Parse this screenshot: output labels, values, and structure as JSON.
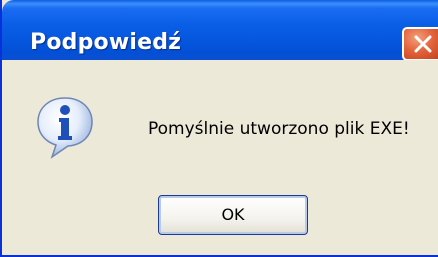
{
  "dialog": {
    "title": "Podpowiedź",
    "message": "Pomyślnie utworzono plik EXE!",
    "ok_label": "OK",
    "icon": "info-icon",
    "close_icon": "close-icon"
  },
  "colors": {
    "titlebar": "#0a5fe7",
    "body": "#ece9d8",
    "close_button": "#e2633b",
    "frame_border": "#0831d9"
  }
}
